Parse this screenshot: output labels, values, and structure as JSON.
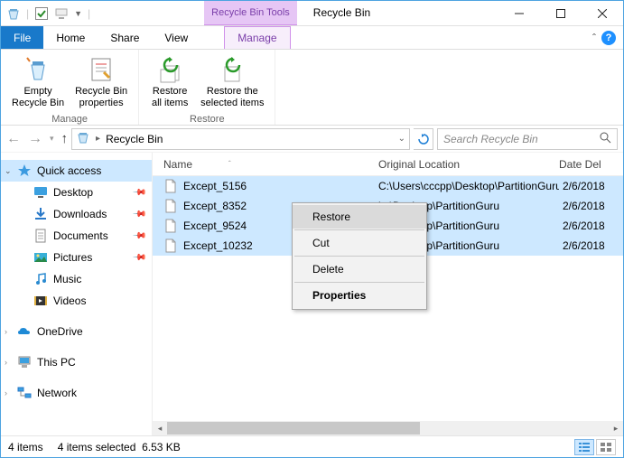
{
  "window": {
    "tools_tab": "Recycle Bin Tools",
    "title": "Recycle Bin"
  },
  "tabs": {
    "file": "File",
    "home": "Home",
    "share": "Share",
    "view": "View",
    "manage": "Manage"
  },
  "ribbon": {
    "manage_group_label": "Manage",
    "restore_group_label": "Restore",
    "empty": "Empty\nRecycle Bin",
    "properties": "Recycle Bin\nproperties",
    "restore_all": "Restore\nall items",
    "restore_selected": "Restore the\nselected items"
  },
  "address": {
    "location": "Recycle Bin"
  },
  "search": {
    "placeholder": "Search Recycle Bin"
  },
  "sidebar": {
    "quick_access": "Quick access",
    "desktop": "Desktop",
    "downloads": "Downloads",
    "documents": "Documents",
    "pictures": "Pictures",
    "music": "Music",
    "videos": "Videos",
    "onedrive": "OneDrive",
    "this_pc": "This PC",
    "network": "Network"
  },
  "columns": {
    "name": "Name",
    "location": "Original Location",
    "date": "Date Del"
  },
  "rows": [
    {
      "name": "Except_5156",
      "loc": "C:\\Users\\cccpp\\Desktop\\PartitionGuru",
      "date": "2/6/2018"
    },
    {
      "name": "Except_8352",
      "loc": "bs\\Desktop\\PartitionGuru",
      "date": "2/6/2018"
    },
    {
      "name": "Except_9524",
      "loc": "bs\\Desktop\\PartitionGuru",
      "date": "2/6/2018"
    },
    {
      "name": "Except_10232",
      "loc": "bs\\Desktop\\PartitionGuru",
      "date": "2/6/2018"
    }
  ],
  "context_menu": {
    "restore": "Restore",
    "cut": "Cut",
    "delete": "Delete",
    "properties": "Properties"
  },
  "status": {
    "count": "4 items",
    "selected": "4 items selected",
    "size": "6.53 KB"
  }
}
